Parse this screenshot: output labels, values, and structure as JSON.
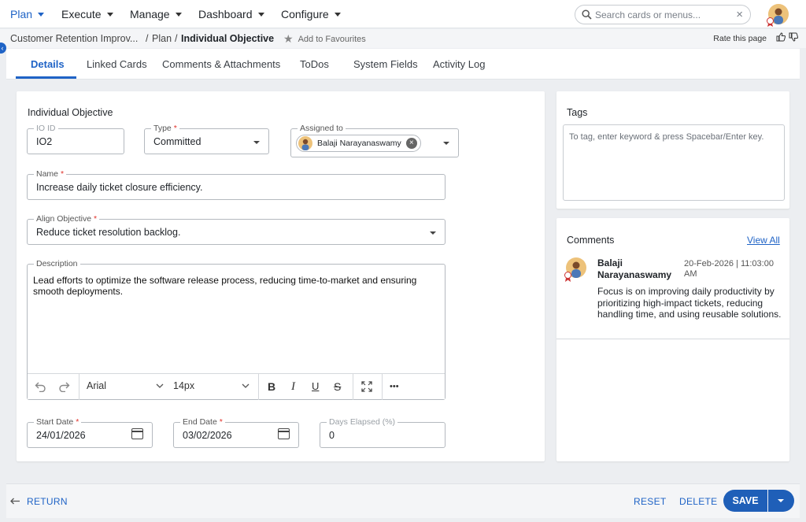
{
  "nav": {
    "items": [
      {
        "label": "Plan",
        "active": true
      },
      {
        "label": "Execute"
      },
      {
        "label": "Manage"
      },
      {
        "label": "Dashboard"
      },
      {
        "label": "Configure"
      }
    ],
    "search_placeholder": "Search cards or menus..."
  },
  "breadcrumb": {
    "parent": "Customer Retention Improv...",
    "separator": "/",
    "section": "Plan",
    "current": "Individual Objective",
    "favourite_label": "Add to Favourites",
    "rate_label": "Rate this page"
  },
  "tabs": [
    "Details",
    "Linked Cards",
    "Comments & Attachments",
    "ToDos",
    "System Fields",
    "Activity Log"
  ],
  "form": {
    "section_title": "Individual Objective",
    "io_id": {
      "label": "IO ID",
      "value": "IO2"
    },
    "type": {
      "label": "Type",
      "value": "Committed"
    },
    "assigned": {
      "label": "Assigned to",
      "value": "Balaji Narayanaswamy"
    },
    "name": {
      "label": "Name",
      "value": "Increase daily ticket closure efficiency."
    },
    "align": {
      "label": "Align Objective",
      "value": "Reduce ticket resolution backlog."
    },
    "description": {
      "label": "Description",
      "value": "Lead efforts to optimize the software release process, reducing time-to-market and ensuring smooth deployments."
    },
    "editor": {
      "font": "Arial",
      "size": "14px",
      "bold": "B",
      "italic": "I",
      "underline": "U",
      "strike": "S",
      "more": "•••"
    },
    "start_date": {
      "label": "Start Date",
      "value": "24/01/2026"
    },
    "end_date": {
      "label": "End Date",
      "value": "03/02/2026"
    },
    "days_elapsed": {
      "label": "Days Elapsed (%)",
      "value": "0"
    }
  },
  "tags": {
    "title": "Tags",
    "placeholder": "To tag, enter keyword & press Spacebar/Enter key."
  },
  "comments": {
    "title": "Comments",
    "view_all": "View All",
    "items": [
      {
        "author_first": "Balaji",
        "author_last": "Narayanaswamy",
        "date": "20-Feb-2026 | 11:03:00",
        "time_suffix": "AM",
        "text": "Focus is on improving daily productivity by prioritizing high-impact tickets, reducing handling time, and using reusable solutions."
      }
    ]
  },
  "footer": {
    "return": "RETURN",
    "reset": "RESET",
    "delete": "DELETE",
    "save": "SAVE"
  },
  "colors": {
    "accent": "#1f63c6",
    "required": "#e0322b",
    "save": "#1f5fb8"
  }
}
